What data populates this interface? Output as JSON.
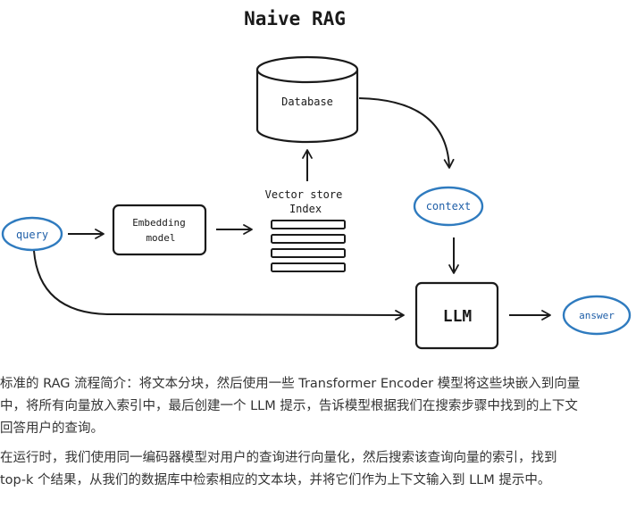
{
  "diagram": {
    "title": "Naive RAG",
    "database_label": "Database",
    "vector_store_label_line1": "Vector store",
    "vector_store_label_line2": "Index",
    "embedding_label_line1": "Embedding",
    "embedding_label_line2": "model",
    "query_label": "query",
    "context_label": "context",
    "llm_label": "LLM",
    "answer_label": "answer",
    "accent_color": "#2f7bbf",
    "ink_color": "#1a1a1a"
  },
  "article": {
    "paragraph1": [
      "标准的 RAG 流程简介：将文本分块，然后使用一些 Transformer Encoder 模型将这些块嵌入到向量",
      "中，将所有向量放入索引中，最后创建一个 LLM 提示，告诉模型根据我们在搜索步骤中找到的上下文",
      "回答用户的查询。"
    ],
    "paragraph2": [
      "在运行时，我们使用同一编码器模型对用户的查询进行向量化，然后搜索该查询向量的索引，找到",
      "top-k 个结果，从我们的数据库中检索相应的文本块，并将它们作为上下文输入到 LLM 提示中。"
    ]
  }
}
